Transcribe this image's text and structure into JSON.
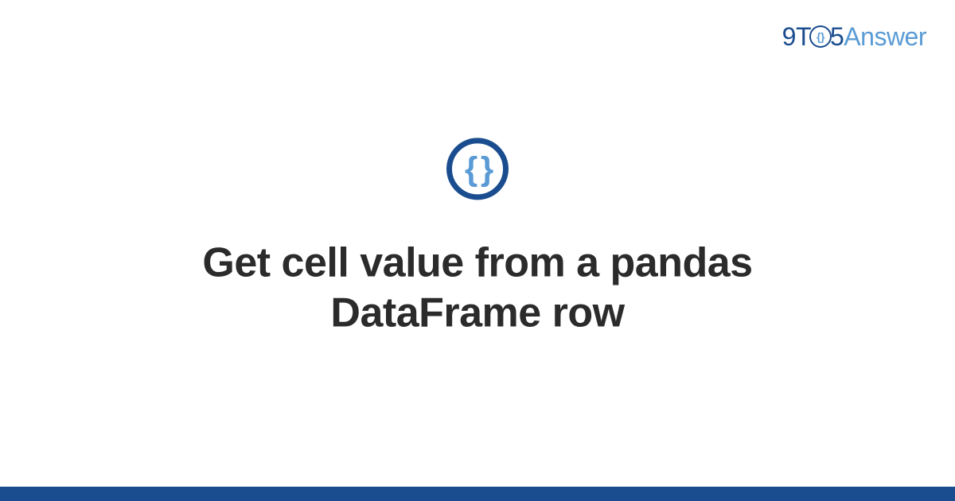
{
  "header": {
    "logo": {
      "prefix": "9T",
      "circle_content": "{}",
      "mid": "5",
      "suffix": "Answer"
    }
  },
  "main": {
    "icon_glyph": "{ }",
    "title": "Get cell value from a pandas DataFrame row"
  }
}
